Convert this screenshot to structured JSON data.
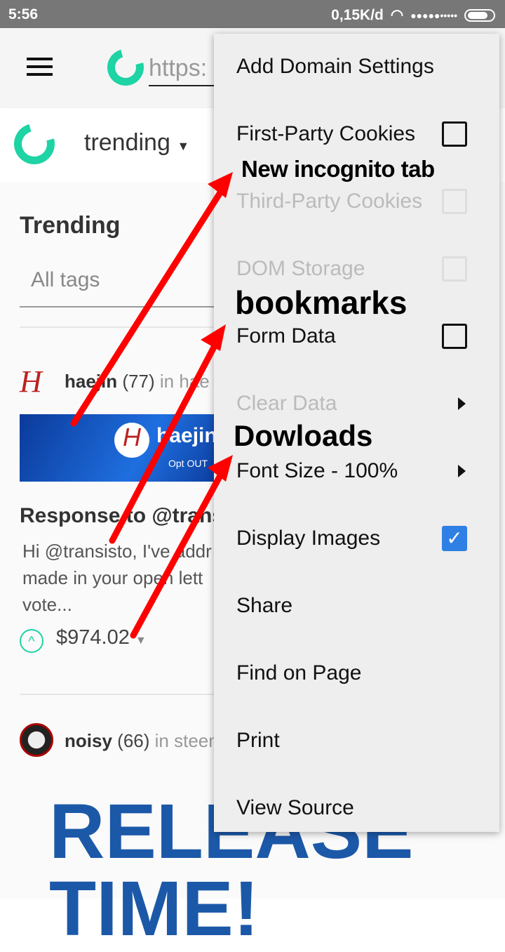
{
  "status": {
    "time": "5:56",
    "speed": "0,15K/d",
    "signal": "●●●●●•••••"
  },
  "toolbar": {
    "url": "https:"
  },
  "site": {
    "feed": "trending"
  },
  "content": {
    "heading": "Trending",
    "tags_placeholder": "All tags",
    "post1": {
      "author": "haejin",
      "rep": "(77)",
      "in": "in hae",
      "banner_text": "haejin",
      "banner_sub": "Opt OUT",
      "title": "Response to @transisto",
      "excerpt": [
        "Hi @transisto, I've addr",
        "made in your open lett",
        "vote..."
      ],
      "payout": "$974.02"
    },
    "post2": {
      "author": "noisy",
      "rep": "(66)",
      "in": "in steem",
      "image_text": [
        "RELEASE",
        "TIME!"
      ]
    }
  },
  "menu": {
    "items": [
      {
        "label": "Add Domain Settings"
      },
      {
        "label": "First-Party Cookies",
        "checkbox": false
      },
      {
        "label": "Third-Party Cookies",
        "checkbox": false,
        "disabled": true
      },
      {
        "label": "DOM Storage",
        "checkbox": false,
        "disabled": true
      },
      {
        "label": "Form Data",
        "checkbox": false
      },
      {
        "label": "Clear Data",
        "submenu": true,
        "disabled": true
      },
      {
        "label": "Font Size - 100%",
        "submenu": true
      },
      {
        "label": "Display Images",
        "checkbox": true
      },
      {
        "label": "Share"
      },
      {
        "label": "Find on Page"
      },
      {
        "label": "Print"
      },
      {
        "label": "View Source"
      }
    ]
  },
  "annotations": [
    "New incognito tab",
    "bookmarks",
    "Dowloads"
  ],
  "colors": {
    "accent": "#1ed3a4",
    "arrow": "#ff0000",
    "checkbox": "#2f80e4"
  }
}
